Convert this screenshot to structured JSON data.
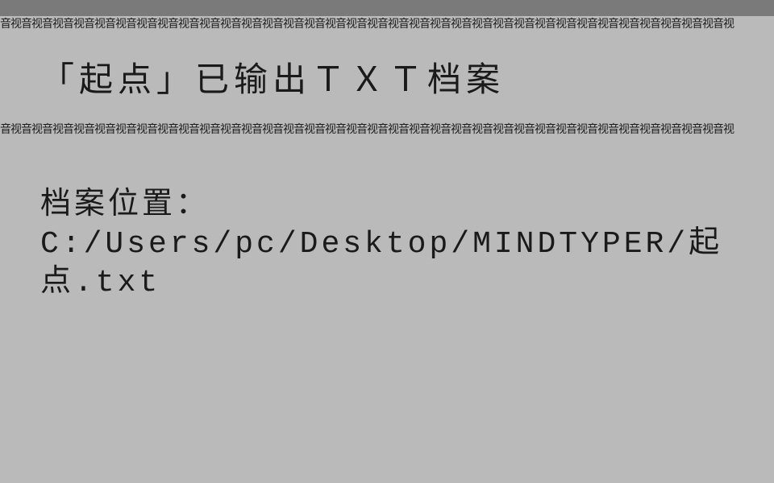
{
  "separator_pattern": "音视音视音视音视音视音视音视音视音视音视音视音视音视音视音视音视音视音视音视音视音视音视音视音视音视音视音视音视音视音视音视音视音视音视音视",
  "title": "「起点」已输出ＴＸＴ档案",
  "body": {
    "label": "档案位置：",
    "path": "C:/Users/pc/Desktop/MINDTYPER/起点.txt"
  }
}
